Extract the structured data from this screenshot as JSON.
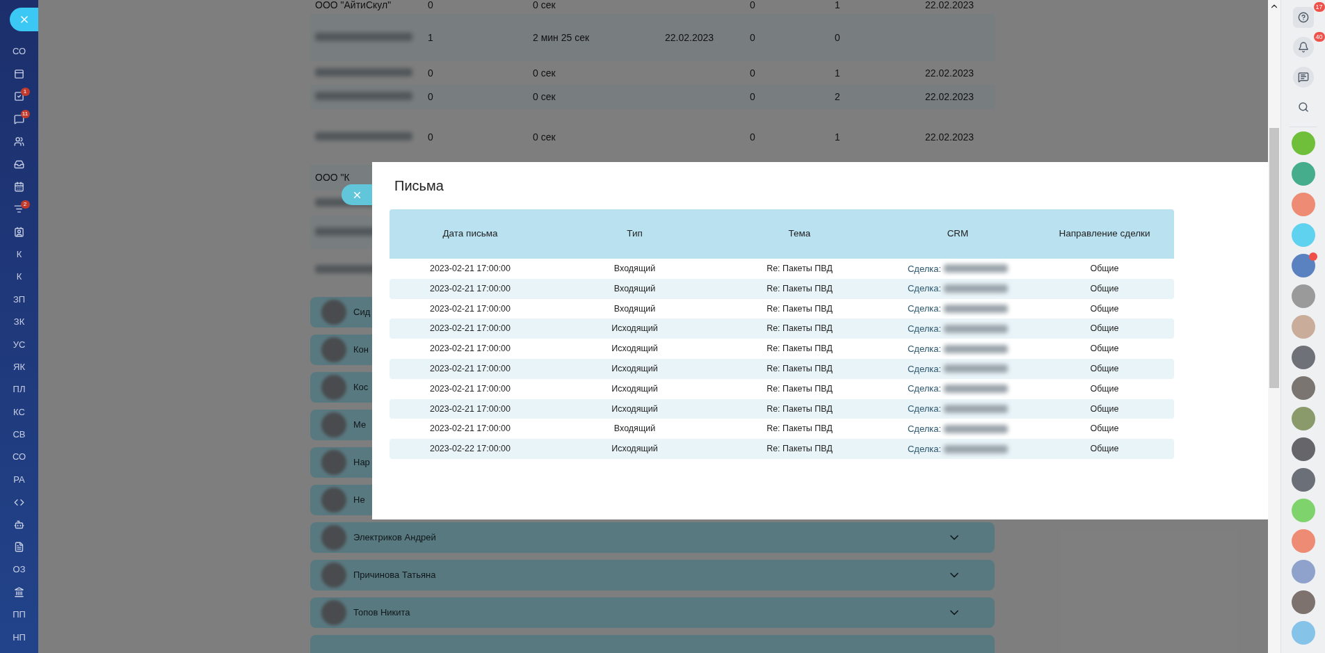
{
  "left_sidebar": {
    "items": [
      {
        "kind": "text",
        "label": "СО"
      },
      {
        "kind": "icon"
      },
      {
        "kind": "icon",
        "badge": "1"
      },
      {
        "kind": "icon",
        "badge": "11"
      },
      {
        "kind": "icon"
      },
      {
        "kind": "icon"
      },
      {
        "kind": "icon"
      },
      {
        "kind": "icon",
        "badge": "2"
      },
      {
        "kind": "icon"
      },
      {
        "kind": "text",
        "label": "К"
      },
      {
        "kind": "text",
        "label": "К"
      },
      {
        "kind": "text",
        "label": "ЗП"
      },
      {
        "kind": "text",
        "label": "ЗК"
      },
      {
        "kind": "text",
        "label": "УС"
      },
      {
        "kind": "text",
        "label": "ЯК"
      },
      {
        "kind": "text",
        "label": "ПЛ"
      },
      {
        "kind": "text",
        "label": "КС"
      },
      {
        "kind": "text",
        "label": "СВ"
      },
      {
        "kind": "text",
        "label": "СО"
      },
      {
        "kind": "text",
        "label": "РА"
      },
      {
        "kind": "icon"
      },
      {
        "kind": "icon"
      },
      {
        "kind": "icon"
      },
      {
        "kind": "text",
        "label": "ОЗ"
      },
      {
        "kind": "icon"
      },
      {
        "kind": "text",
        "label": "ПП"
      },
      {
        "kind": "text",
        "label": "НП"
      }
    ]
  },
  "report_table": {
    "rows": [
      {
        "redacted": false,
        "name": "ООО \"АйтиСкул\"",
        "column_2": "0",
        "column_3": "0 сек",
        "column_5": "0",
        "column_6": "1",
        "column_7": "22.02.2023"
      },
      {
        "redacted": true,
        "column_2": "1",
        "column_3": "2 мин 25 сек",
        "column_4": "22.02.2023",
        "column_5": "0",
        "column_6": "0"
      },
      {
        "redacted": true,
        "column_2": "0",
        "column_3": "0 сек",
        "column_5": "0",
        "column_6": "1",
        "column_7": "22.02.2023"
      },
      {
        "redacted": true,
        "column_2": "0",
        "column_3": "0 сек",
        "column_5": "0",
        "column_6": "2",
        "column_7": "22.02.2023"
      },
      {
        "redacted": true,
        "column_2": "0",
        "column_3": "0 сек",
        "column_5": "0",
        "column_6": "1",
        "column_7": "22.02.2023"
      },
      {
        "redacted": false,
        "name": "ООО \"К"
      },
      {
        "redacted": true
      },
      {
        "redacted": true
      },
      {
        "redacted": true
      }
    ]
  },
  "employees": [
    {
      "name": "Сид"
    },
    {
      "name": "Кон"
    },
    {
      "name": "Кос"
    },
    {
      "name": "Ме"
    },
    {
      "name": "Нар"
    },
    {
      "name": "Не"
    },
    {
      "name": "Электриков Андрей"
    },
    {
      "name": "Причинова Татьяна"
    },
    {
      "name": "Топов Никита"
    }
  ],
  "modal": {
    "title": "Письма",
    "columns": [
      "Дата письма",
      "Тип",
      "Тема",
      "CRM",
      "Направление сделки"
    ],
    "rows": [
      {
        "date": "2023-02-21 17:00:00",
        "type": "Входящий",
        "subject": "Re: Пакеты ПВД",
        "crm_label": "Сделка:",
        "crm_redacted": true,
        "direction": "Общие"
      },
      {
        "date": "2023-02-21 17:00:00",
        "type": "Входящий",
        "subject": "Re: Пакеты ПВД",
        "crm_label": "Сделка:",
        "crm_redacted": true,
        "direction": "Общие"
      },
      {
        "date": "2023-02-21 17:00:00",
        "type": "Входящий",
        "subject": "Re: Пакеты ПВД",
        "crm_label": "Сделка:",
        "crm_redacted": true,
        "direction": "Общие"
      },
      {
        "date": "2023-02-21 17:00:00",
        "type": "Исходящий",
        "subject": "Re: Пакеты ПВД",
        "crm_label": "Сделка:",
        "crm_redacted": true,
        "direction": "Общие"
      },
      {
        "date": "2023-02-21 17:00:00",
        "type": "Исходящий",
        "subject": "Re: Пакеты ПВД",
        "crm_label": "Сделка:",
        "crm_redacted": true,
        "direction": "Общие"
      },
      {
        "date": "2023-02-21 17:00:00",
        "type": "Исходящий",
        "subject": "Re: Пакеты ПВД",
        "crm_label": "Сделка:",
        "crm_redacted": true,
        "direction": "Общие"
      },
      {
        "date": "2023-02-21 17:00:00",
        "type": "Исходящий",
        "subject": "Re: Пакеты ПВД",
        "crm_label": "Сделка:",
        "crm_redacted": true,
        "direction": "Общие"
      },
      {
        "date": "2023-02-21 17:00:00",
        "type": "Исходящий",
        "subject": "Re: Пакеты ПВД",
        "crm_label": "Сделка:",
        "crm_redacted": true,
        "direction": "Общие"
      },
      {
        "date": "2023-02-21 17:00:00",
        "type": "Входящий",
        "subject": "Re: Пакеты ПВД",
        "crm_label": "Сделка:",
        "crm_redacted": true,
        "direction": "Общие"
      },
      {
        "date": "2023-02-22 17:00:00",
        "type": "Исходящий",
        "subject": "Re: Пакеты ПВД",
        "crm_label": "Сделка:",
        "crm_redacted": true,
        "direction": "Общие"
      }
    ]
  },
  "right_sidebar": {
    "buttons": [
      {
        "kind": "button",
        "badge": "17"
      },
      {
        "kind": "button",
        "badge": "40"
      },
      {
        "kind": "button"
      },
      {
        "kind": "button"
      }
    ],
    "avatars": [
      {
        "color": "#6fbf3a",
        "badge": false
      },
      {
        "color": "#45ad8c",
        "badge": false
      },
      {
        "color": "#ee8b75",
        "badge": false
      },
      {
        "color": "#5fd2f0",
        "badge": false
      },
      {
        "color": "#5b82c0",
        "badge": true
      },
      {
        "color": "#9a9a9a",
        "badge": false
      },
      {
        "color": "#c9ad9a",
        "badge": false
      },
      {
        "color": "#6e7178",
        "badge": false
      },
      {
        "color": "#7a7570",
        "badge": false
      },
      {
        "color": "#8b9a6a",
        "badge": false
      },
      {
        "color": "#66666a",
        "badge": false
      },
      {
        "color": "#6b6f78",
        "badge": false
      },
      {
        "color": "#7ed36c",
        "badge": false
      },
      {
        "color": "#ee8b75",
        "badge": false
      },
      {
        "color": "#8ea2cc",
        "badge": false
      },
      {
        "color": "#7d726d",
        "badge": false
      },
      {
        "color": "#86c3e8",
        "badge": false
      }
    ]
  }
}
